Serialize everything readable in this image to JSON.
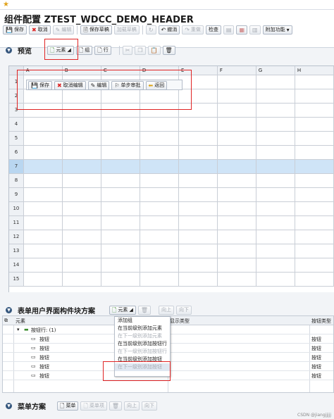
{
  "topstrip": {
    "star_icon": "star-icon"
  },
  "title": "组件配置 ZTEST_WDCC_DEMO_HEADER",
  "toolbar": {
    "save": "保存",
    "cancel": "取消",
    "edit": "编辑",
    "save_draft": "保存草稿",
    "add_draft": "加载草稿",
    "undo": "撤消",
    "redo": "重做",
    "check": "检查",
    "extras": "附加功能"
  },
  "preview": {
    "title": "预览",
    "buttons": {
      "element": "元素",
      "group": "组",
      "row": "行"
    }
  },
  "sheet": {
    "columns": [
      "A",
      "B",
      "C",
      "D",
      "E",
      "F",
      "G",
      "H"
    ],
    "rows": [
      "1",
      "2",
      "3",
      "4",
      "5",
      "6",
      "7",
      "8",
      "9",
      "10",
      "11",
      "12",
      "13",
      "14",
      "15"
    ],
    "selected_row": "7"
  },
  "inner_toolbar": {
    "save": "保存",
    "cancel_edit": "取消编辑",
    "edit": "编辑",
    "single_step": "单步审批",
    "back": "返回"
  },
  "ui_section": {
    "title": "表单用户界面构件块方案",
    "buttons": {
      "element": "元素",
      "up": "向上",
      "down": "向下"
    },
    "columns": {
      "element": "元素",
      "display_type": "显示类型",
      "button_type": "按钮类型"
    },
    "group_row": "按钮行: (1)",
    "items": [
      {
        "name": "按钮",
        "type": "按钮"
      },
      {
        "name": "按钮",
        "type": "按钮"
      },
      {
        "name": "按钮",
        "type": "按钮"
      },
      {
        "name": "按钮",
        "type": "按钮"
      },
      {
        "name": "按钮",
        "type": "按钮"
      }
    ]
  },
  "dropdown": {
    "items": [
      {
        "label": "添加组",
        "enabled": true
      },
      {
        "label": "在当前级别添加元素",
        "enabled": true
      },
      {
        "label": "在下一级别添加元素",
        "enabled": false
      },
      {
        "label": "在当前级别添加按钮行",
        "enabled": true
      },
      {
        "label": "在下一级别添加按钮行",
        "enabled": false
      },
      {
        "label": "在当前级别添加按钮",
        "enabled": true
      },
      {
        "label": "在下一级别添加按钮",
        "enabled": false
      }
    ]
  },
  "menu_section": {
    "title": "菜单方案",
    "buttons": {
      "menu": "菜单",
      "menu_item": "菜单项",
      "up": "向上",
      "down": "向下"
    }
  },
  "watermark": "CSDN @jiangjjjjj",
  "colors": {
    "accent": "#36577e",
    "selected_row": "#cfe4f7",
    "highlight_box": "#e02424"
  }
}
